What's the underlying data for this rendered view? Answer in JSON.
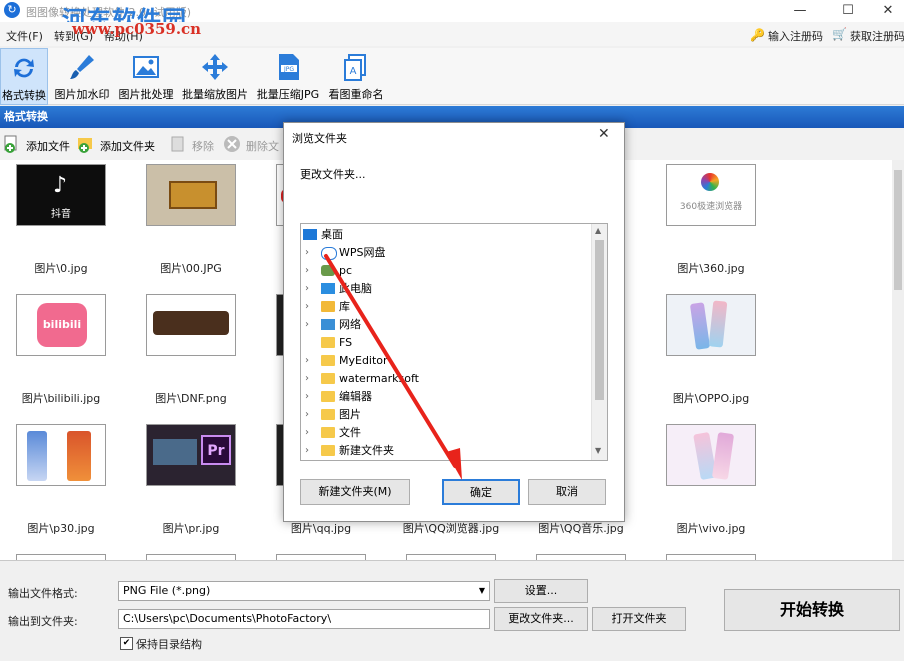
{
  "window": {
    "title": "图图像转换处理软件 2.0 (试用版)",
    "watermark": "河东软件园",
    "watermark_url": "www.pc0359.cn",
    "controls": [
      "—",
      "☐",
      "✕"
    ]
  },
  "menu": {
    "items": [
      "文件(F)",
      "转到(G)",
      "帮助(H)"
    ],
    "register": "输入注册码",
    "get_register": "获取注册码"
  },
  "toolbar": {
    "items": [
      {
        "label": "格式转换"
      },
      {
        "label": "图片加水印"
      },
      {
        "label": "图片批处理"
      },
      {
        "label": "批量缩放图片"
      },
      {
        "label": "批量压缩JPG"
      },
      {
        "label": "看图重命名"
      }
    ]
  },
  "section": {
    "title": "格式转换"
  },
  "subtoolbar": {
    "add_file": "添加文件",
    "add_folder": "添加文件夹",
    "remove": "移除",
    "delete": "删除文"
  },
  "thumbnails": [
    {
      "caption": "图片\\0.jpg",
      "art": "抖音"
    },
    {
      "caption": "图片\\00.JPG",
      "art": ""
    },
    {
      "caption": "图片\\360.jpg",
      "art": "360极速浏览器"
    },
    {
      "caption": "图片\\bilibili.jpg",
      "art": "bilibili"
    },
    {
      "caption": "图片\\DNF.png",
      "art": ""
    },
    {
      "caption": "图片\\OPPO.jpg",
      "art": ""
    },
    {
      "caption": "图片\\p30.jpg",
      "art": ""
    },
    {
      "caption": "图片\\pr.jpg",
      "art": "Pr"
    },
    {
      "caption": "图片\\qq.jpg",
      "art": ""
    },
    {
      "caption": "图片\\QQ浏览器.jpg",
      "art": ""
    },
    {
      "caption": "图片\\QQ音乐.jpg",
      "art": ""
    },
    {
      "caption": "图片\\vivo.jpg",
      "art": ""
    }
  ],
  "bottom": {
    "format_label": "输出文件格式:",
    "format_value": "PNG File (*.png)",
    "settings_btn": "设置...",
    "folder_label": "输出到文件夹:",
    "folder_value": "C:\\Users\\pc\\Documents\\PhotoFactory\\",
    "change_folder_btn": "更改文件夹...",
    "open_folder_btn": "打开文件夹",
    "keep_structure": "保持目录结构",
    "start_btn": "开始转换"
  },
  "dialog": {
    "title": "浏览文件夹",
    "description": "更改文件夹...",
    "tree": [
      {
        "label": "桌面",
        "icon": "desktop-icon",
        "expandable": false
      },
      {
        "label": "WPS网盘",
        "icon": "cloud-icon",
        "expandable": true
      },
      {
        "label": "pc",
        "icon": "user-icon",
        "expandable": true
      },
      {
        "label": "此电脑",
        "icon": "computer-icon",
        "expandable": true
      },
      {
        "label": "库",
        "icon": "library-icon",
        "expandable": true
      },
      {
        "label": "网络",
        "icon": "network-icon",
        "expandable": true
      },
      {
        "label": "FS",
        "icon": "folder-icon",
        "expandable": false
      },
      {
        "label": "MyEditor",
        "icon": "folder-icon",
        "expandable": true
      },
      {
        "label": "watermarksoft",
        "icon": "folder-icon",
        "expandable": true
      },
      {
        "label": "编辑器",
        "icon": "folder-icon",
        "expandable": true
      },
      {
        "label": "图片",
        "icon": "folder-icon",
        "expandable": true
      },
      {
        "label": "文件",
        "icon": "folder-icon",
        "expandable": true
      },
      {
        "label": "新建文件夹",
        "icon": "folder-icon",
        "expandable": true
      }
    ],
    "new_folder_btn": "新建文件夹(M)",
    "ok_btn": "确定",
    "cancel_btn": "取消"
  },
  "colors": {
    "accent": "#1d6fd8",
    "annotation": "#e8231b"
  }
}
